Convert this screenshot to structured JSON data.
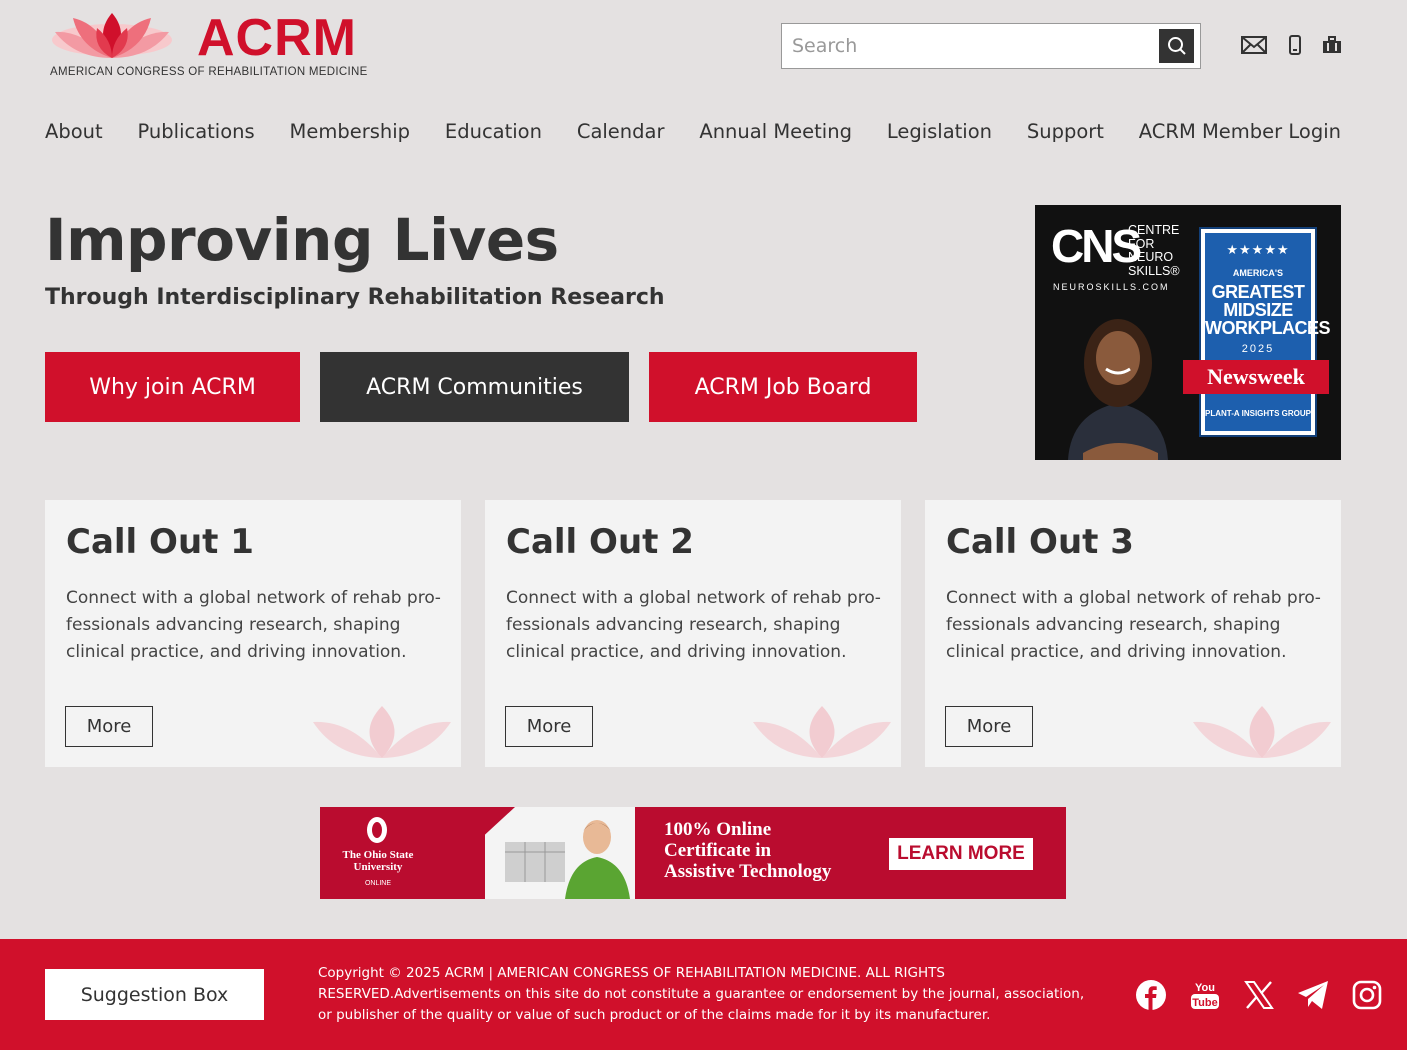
{
  "brand": {
    "name": "ACRM",
    "full_name": "AMERICAN CONGRESS OF REHABILITATION MEDICINE",
    "accent_color": "#d0102b",
    "dark_color": "#333333"
  },
  "search": {
    "placeholder": "Search",
    "button_icon": "search-icon"
  },
  "utility_icons": [
    "mail-icon",
    "phone-icon",
    "briefcase-icon"
  ],
  "nav": {
    "items": [
      {
        "label": "About"
      },
      {
        "label": "Publications"
      },
      {
        "label": "Membership"
      },
      {
        "label": "Education"
      },
      {
        "label": "Calendar"
      },
      {
        "label": "Annual Meeting"
      },
      {
        "label": "Legislation"
      },
      {
        "label": "Support"
      },
      {
        "label": "ACRM Member Login"
      }
    ]
  },
  "hero": {
    "title": "Improving Lives",
    "subtitle": "Through Interdisciplinary Rehabilitation Research",
    "buttons": [
      {
        "label": "Why join ACRM",
        "style": "red"
      },
      {
        "label": "ACRM Communities",
        "style": "dark"
      },
      {
        "label": "ACRM Job Board",
        "style": "red"
      }
    ]
  },
  "ad_cns": {
    "logo": "CNS",
    "tagline_1": "CENTRE",
    "tagline_2": "FOR",
    "tagline_3": "NEURO",
    "tagline_4": "SKILLS®",
    "url": "NEUROSKILLS.COM",
    "badge_stars": "★★★★★",
    "badge_line1": "AMERICA'S",
    "badge_line2": "GREATEST MIDSIZE WORKPLACES",
    "badge_year": "2025",
    "badge_ribbon": "Newsweek",
    "badge_footer": "PLANT-A INSIGHTS GROUP"
  },
  "callouts": [
    {
      "title": "Call Out 1",
      "body": "Connect with a global network of rehab pro­fessionals advancing research, shaping clinical practice, and driving innovation.",
      "button": "More"
    },
    {
      "title": "Call Out 2",
      "body": "Connect with a global network of rehab pro­fessionals advancing research, shaping clinical practice, and driving innovation.",
      "button": "More"
    },
    {
      "title": "Call Out 3",
      "body": "Connect with a global network of rehab pro­fessionals advancing research, shaping clinical practice, and driving innovation.",
      "button": "More"
    }
  ],
  "banner": {
    "org_line1": "The Ohio State",
    "org_line2": "University",
    "org_online": "ONLINE",
    "headline_1": "100% Online",
    "headline_2": "Certificate in",
    "headline_3": "Assistive Technology",
    "cta": "LEARN MORE",
    "color": "#ba0c2f"
  },
  "footer": {
    "suggestion_button": "Suggestion Box",
    "copyright": "Copyright © 2025 ACRM | AMERICAN CONGRESS OF REHABILITATION MEDICINE. ALL RIGHTS RESERVED.Advertisements on this site do not constitute a guarantee or endorsement by the journal, association, or publisher of the quality or value of such product or of the claims made for it by its manufacturer.",
    "social_icons": [
      "facebook-icon",
      "youtube-icon",
      "x-icon",
      "telegram-icon",
      "instagram-icon"
    ]
  }
}
